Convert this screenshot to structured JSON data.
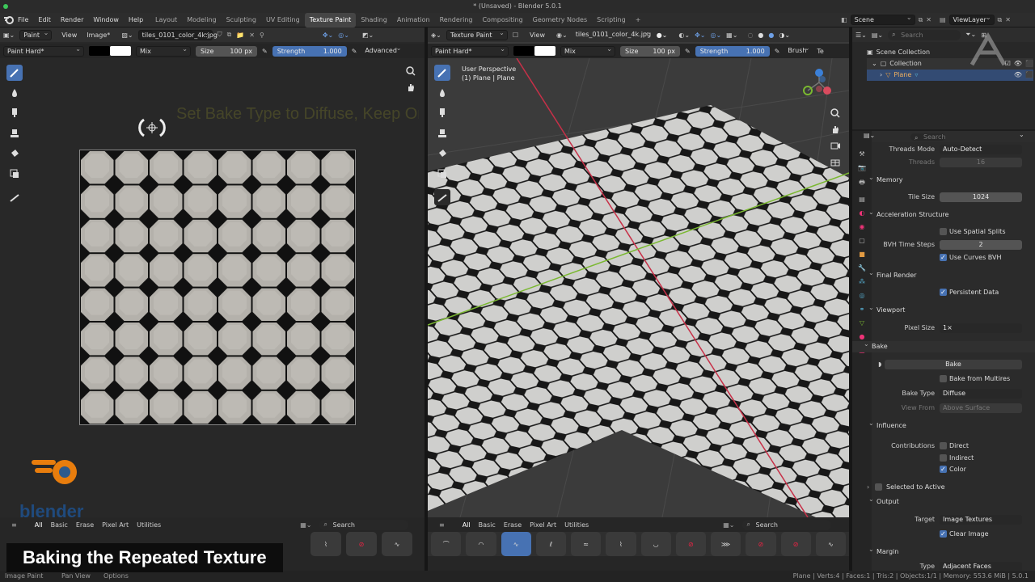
{
  "window": {
    "title": "* (Unsaved) - Blender 5.0.1"
  },
  "menu": [
    "File",
    "Edit",
    "Render",
    "Window",
    "Help"
  ],
  "workspaces": [
    "Layout",
    "Modeling",
    "Sculpting",
    "UV Editing",
    "Texture Paint",
    "Shading",
    "Animation",
    "Rendering",
    "Compositing",
    "Geometry Nodes",
    "Scripting"
  ],
  "active_workspace": "Texture Paint",
  "scene": {
    "name": "Scene",
    "view_layer": "ViewLayer",
    "search_placeholder": "Search"
  },
  "image_editor": {
    "mode": "Paint",
    "view": "View",
    "image_menu": "Image*",
    "image_name": "tiles_0101_color_4k.jpg",
    "brush": "Paint Hard*",
    "blend": "Mix",
    "size_label": "Size",
    "size_value": "100 px",
    "strength_label": "Strength",
    "strength_value": "1.000",
    "advanced": "Advanced",
    "overlay_text": "Set Bake Type to Diffuse, Keep Only Color, then set Target to Image Texture"
  },
  "viewport": {
    "mode": "Texture Paint",
    "view": "View",
    "image_name": "tiles_0101_color_4k.jpg",
    "brush": "Paint Hard*",
    "blend": "Mix",
    "size_label": "Size",
    "size_value": "100 px",
    "strength_label": "Strength",
    "strength_value": "1.000",
    "brush_menu": "Brush",
    "extra": "Te",
    "perspective": "User Perspective",
    "object": "(1) Plane | Plane"
  },
  "brush_tabs": [
    "All",
    "Basic",
    "Erase",
    "Pixel Art",
    "Utilities"
  ],
  "outliner": {
    "root": "Scene Collection",
    "collection": "Collection",
    "object": "Plane"
  },
  "properties": {
    "search_placeholder": "Search",
    "threads_mode": {
      "label": "Threads Mode",
      "value": "Auto-Detect"
    },
    "threads": {
      "label": "Threads",
      "value": "16"
    },
    "memory": "Memory",
    "tile_size": {
      "label": "Tile Size",
      "value": "1024"
    },
    "accel": "Acceleration Structure",
    "spatial_splits": "Use Spatial Splits",
    "bvh_steps": {
      "label": "BVH Time Steps",
      "value": "2"
    },
    "curves_bvh": "Use Curves BVH",
    "final_render": "Final Render",
    "persistent": "Persistent Data",
    "viewport": "Viewport",
    "pixel_size": {
      "label": "Pixel Size",
      "value": "1×"
    },
    "bake": "Bake",
    "bake_button": "Bake",
    "bake_multires": "Bake from Multires",
    "bake_type": {
      "label": "Bake Type",
      "value": "Diffuse"
    },
    "view_from": {
      "label": "View From",
      "value": "Above Surface"
    },
    "influence": "Influence",
    "contributions": "Contributions",
    "direct": "Direct",
    "indirect": "Indirect",
    "color": "Color",
    "selected_active": "Selected to Active",
    "output": "Output",
    "target": {
      "label": "Target",
      "value": "Image Textures"
    },
    "clear_image": "Clear Image",
    "margin": "Margin",
    "margin_type": {
      "label": "Type",
      "value": "Adjacent Faces"
    }
  },
  "status": {
    "left": [
      "Image Paint",
      "Pan View",
      "Options"
    ],
    "right": "Plane | Verts:4 | Faces:1 | Tris:2 | Objects:1/1 | Memory: 553.6 MiB | 5.0.1"
  },
  "logo_text": "blender",
  "caption": "Baking the Repeated Texture"
}
